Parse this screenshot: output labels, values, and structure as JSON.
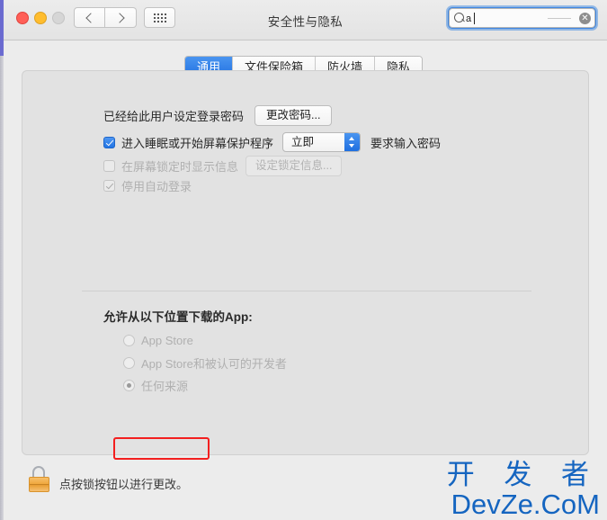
{
  "window": {
    "title": "安全性与隐私",
    "traffic_lights": [
      "close",
      "minimize",
      "zoom"
    ],
    "nav_back_icon": "chevron-left-icon",
    "nav_forward_icon": "chevron-right-icon",
    "grid_icon": "grid-view-icon"
  },
  "search": {
    "value": "a",
    "icon": "search-icon",
    "clear_icon": "clear-circle-icon",
    "clear_glyph": "✕"
  },
  "tabs": [
    {
      "label": "通用",
      "active": true
    },
    {
      "label": "文件保险箱",
      "active": false
    },
    {
      "label": "防火墙",
      "active": false
    },
    {
      "label": "隐私",
      "active": false
    }
  ],
  "general": {
    "password_label": "已经给此用户设定登录密码",
    "change_password_button": "更改密码...",
    "sleep_checkbox_label": "进入睡眠或开始屏幕保护程序",
    "sleep_checkbox_checked": true,
    "sleep_delay_value": "立即",
    "sleep_delay_suffix": "要求输入密码",
    "lock_message_label": "在屏幕锁定时显示信息",
    "lock_message_checked": false,
    "lock_message_button": "设定锁定信息...",
    "disable_autologin_label": "停用自动登录",
    "disable_autologin_checked": true
  },
  "downloads": {
    "title": "允许从以下位置下载的App:",
    "options": [
      {
        "label": "App Store",
        "selected": false
      },
      {
        "label": "App Store和被认可的开发者",
        "selected": false
      },
      {
        "label": "任何来源",
        "selected": true
      }
    ],
    "highlight_color": "#f31f1f"
  },
  "footer": {
    "lock_icon": "unlocked-padlock-icon",
    "text": "点按锁按钮以进行更改。"
  },
  "watermark": {
    "line1": "开 发 者",
    "line2": "DevZe.CoM",
    "color": "#1565c0"
  }
}
